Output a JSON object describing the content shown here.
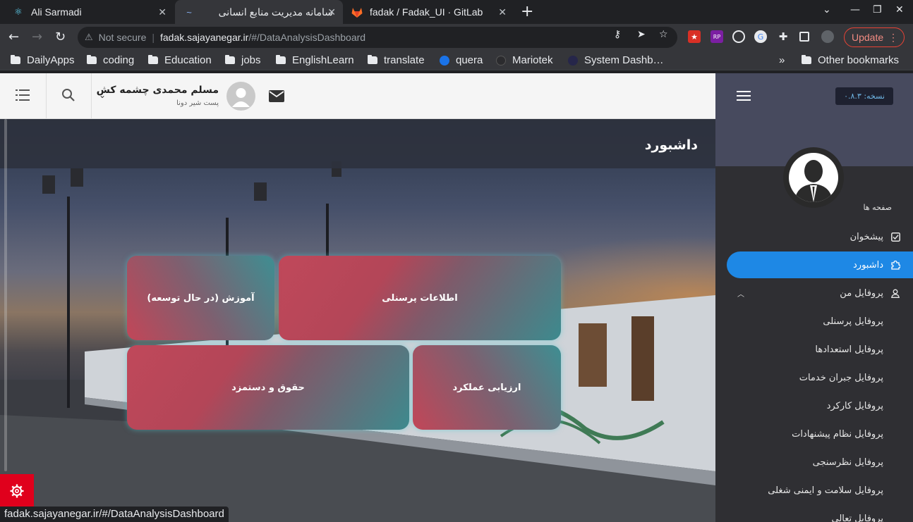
{
  "browser": {
    "tabs": [
      {
        "title": "Ali Sarmadi",
        "icon": "react-icon",
        "active": false
      },
      {
        "title": "سامانه مدیریت منابع انسانی",
        "icon": "app-icon",
        "active": true
      },
      {
        "title": "fadak / Fadak_UI · GitLab",
        "icon": "gitlab-icon",
        "active": false
      }
    ],
    "new_tab": "+",
    "address": {
      "security": "Not secure",
      "separator": "|",
      "host": "fadak.sajayanegar.ir",
      "path": "/#/DataAnalysisDashboard"
    },
    "update_button": "Update",
    "bookmarks": [
      {
        "label": "DailyApps",
        "type": "folder"
      },
      {
        "label": "coding",
        "type": "folder"
      },
      {
        "label": "Education",
        "type": "folder"
      },
      {
        "label": "jobs",
        "type": "folder"
      },
      {
        "label": "EnglishLearn",
        "type": "folder"
      },
      {
        "label": "translate",
        "type": "folder"
      },
      {
        "label": "quera",
        "type": "site"
      },
      {
        "label": "Mariotek",
        "type": "site"
      },
      {
        "label": "System Dashb…",
        "type": "site"
      }
    ],
    "bookmarks_overflow": "»",
    "other_bookmarks": "Other bookmarks",
    "status_url": "fadak.sajayanegar.ir/#/DataAnalysisDashboard"
  },
  "appbar": {
    "user_name": "مسلم محمدی چشمه کش",
    "user_role": "پست شیر دونا"
  },
  "page": {
    "title": "داشبورد"
  },
  "cards": [
    {
      "label": "اطلاعات پرسنلی"
    },
    {
      "label": "آموزش (در حال توسعه)"
    },
    {
      "label": "ارزیابی عملکرد"
    },
    {
      "label": "حقوق و دستمزد"
    }
  ],
  "sidebar": {
    "version": "نسخه: ۰.۸.۳",
    "pages_label": "صفحه ها",
    "items": [
      {
        "label": "پیشخوان",
        "icon": "checkbox-icon",
        "active": false
      },
      {
        "label": "داشبورد",
        "icon": "puzzle-icon",
        "active": true
      },
      {
        "label": "پروفایل من",
        "icon": "person-icon",
        "active": false,
        "expanded": true
      },
      {
        "label": "پروفایل پرسنلی",
        "sub": true
      },
      {
        "label": "پروفایل استعدادها",
        "sub": true
      },
      {
        "label": "پروفایل جبران خدمات",
        "sub": true
      },
      {
        "label": "پروفایل کارکرد",
        "sub": true
      },
      {
        "label": "پروفایل نظام پیشنهادات",
        "sub": true
      },
      {
        "label": "پروفایل نظرسنجی",
        "sub": true
      },
      {
        "label": "پروفایل سلامت و ایمنی شغلی",
        "sub": true
      },
      {
        "label": "پروفایل تعالی",
        "sub": true
      }
    ]
  },
  "colors": {
    "accent": "#1e88e5",
    "sidebar_bg": "#2f2f33",
    "fab": "#e0001c",
    "card_red": "#c0485a",
    "card_teal": "#3d8a8e"
  }
}
